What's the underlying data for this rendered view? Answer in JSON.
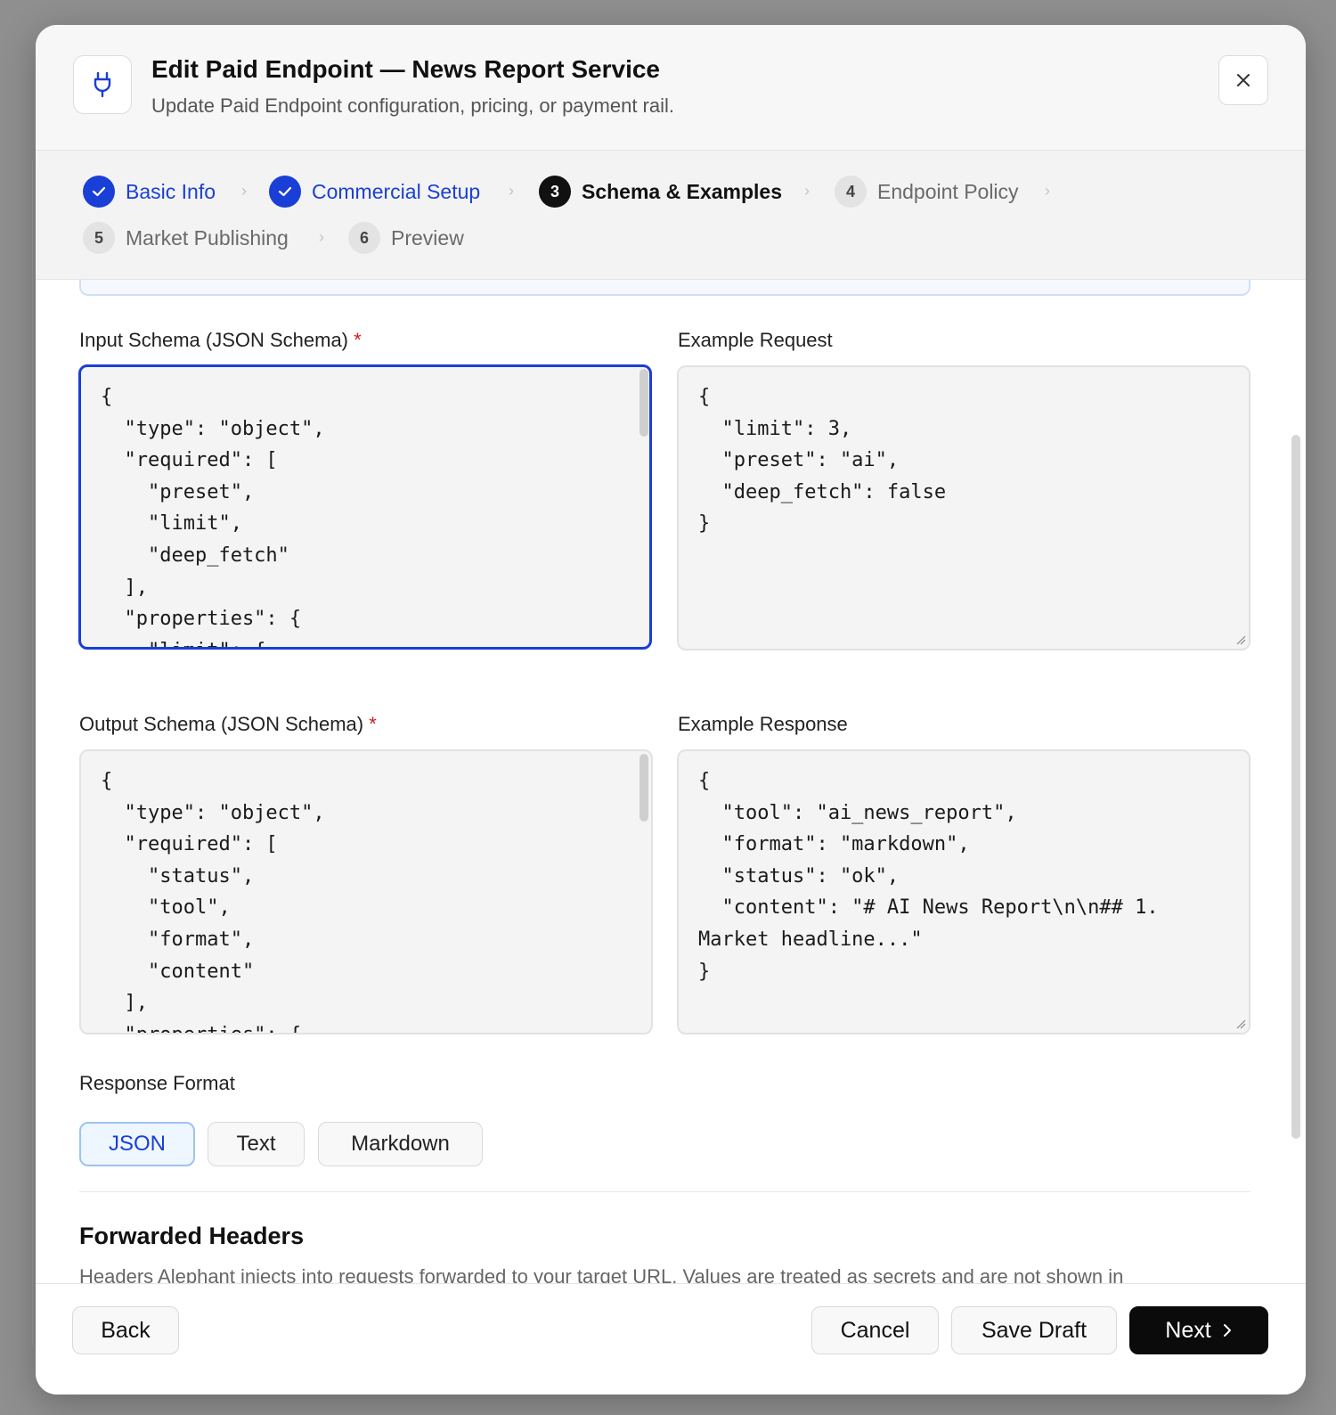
{
  "dialog": {
    "title": "Edit Paid Endpoint — News Report Service",
    "subtitle": "Update Paid Endpoint configuration, pricing, or payment rail.",
    "icon": "plug-icon",
    "close_icon": "close-icon"
  },
  "steps": [
    {
      "num": "1",
      "label": "Basic Info",
      "state": "done"
    },
    {
      "num": "2",
      "label": "Commercial Setup",
      "state": "done"
    },
    {
      "num": "3",
      "label": "Schema & Examples",
      "state": "active"
    },
    {
      "num": "4",
      "label": "Endpoint Policy",
      "state": "todo"
    },
    {
      "num": "5",
      "label": "Market Publishing",
      "state": "todo"
    },
    {
      "num": "6",
      "label": "Preview",
      "state": "todo"
    }
  ],
  "fields": {
    "input_schema": {
      "label": "Input Schema (JSON Schema)",
      "required_mark": "*",
      "value": "{\n  \"type\": \"object\",\n  \"required\": [\n    \"preset\",\n    \"limit\",\n    \"deep_fetch\"\n  ],\n  \"properties\": {\n    \"limit\": {"
    },
    "example_request": {
      "label": "Example Request",
      "value": "{\n  \"limit\": 3,\n  \"preset\": \"ai\",\n  \"deep_fetch\": false\n}"
    },
    "output_schema": {
      "label": "Output Schema (JSON Schema)",
      "required_mark": "*",
      "value": "{\n  \"type\": \"object\",\n  \"required\": [\n    \"status\",\n    \"tool\",\n    \"format\",\n    \"content\"\n  ],\n  \"properties\": {"
    },
    "example_response": {
      "label": "Example Response",
      "value": "{\n  \"tool\": \"ai_news_report\",\n  \"format\": \"markdown\",\n  \"status\": \"ok\",\n  \"content\": \"# AI News Report\\n\\n## 1.\nMarket headline...\"\n}"
    }
  },
  "response_format": {
    "label": "Response Format",
    "options": [
      "JSON",
      "Text",
      "Markdown"
    ],
    "selected": "JSON"
  },
  "forwarded_headers": {
    "title": "Forwarded Headers",
    "description": "Headers Alephant injects into requests forwarded to your target URL. Values are treated as secrets and are not shown in"
  },
  "footer": {
    "back": "Back",
    "cancel": "Cancel",
    "save_draft": "Save Draft",
    "next": "Next"
  },
  "colors": {
    "accent": "#1a3fd6",
    "primary_button": "#0b0b0b",
    "required": "#d01c1c"
  }
}
